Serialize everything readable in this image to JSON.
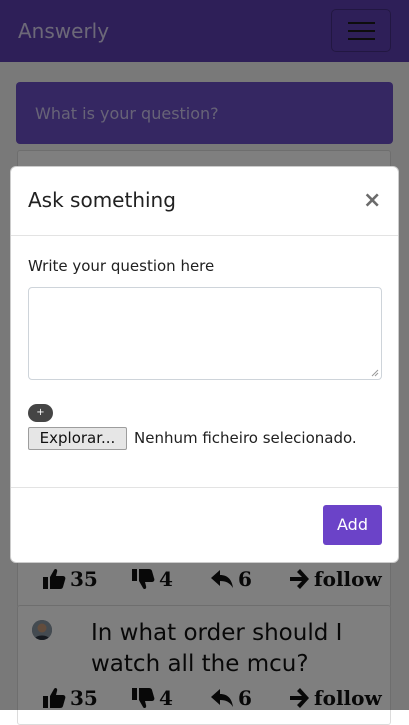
{
  "navbar": {
    "brand": "Answerly",
    "menu_icon": "hamburger-icon"
  },
  "ask_bar": {
    "placeholder": "What is your question?"
  },
  "feed": {
    "cards": [
      {
        "likes": "35",
        "dislikes": "4",
        "replies": "6",
        "follow": "follow"
      },
      {
        "title": "In what order should I watch all the mcu?",
        "likes": "35",
        "dislikes": "4",
        "replies": "6",
        "follow": "follow"
      }
    ]
  },
  "modal": {
    "title": "Ask something",
    "close": "×",
    "question_label": "Write your question here",
    "add_attachment": "+",
    "file_button": "Explorar...",
    "file_status": "Nenhum ficheiro selecionado.",
    "submit": "Add"
  },
  "colors": {
    "brand": "#5d3fb0",
    "accent": "#6b43c8"
  }
}
